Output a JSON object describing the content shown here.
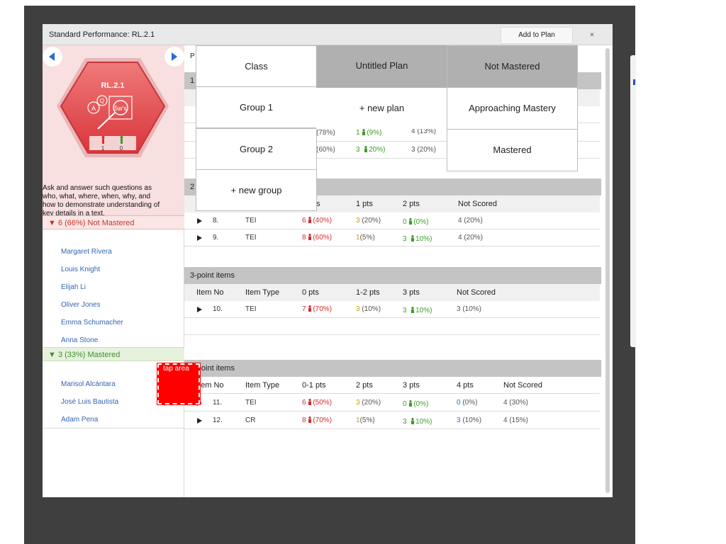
{
  "window": {
    "title": "Standard Performance: RL.2.1",
    "add_to_plan": "Add to Plan",
    "close": "×"
  },
  "standard": {
    "code": "RL.2.1",
    "icon_text": "5w's",
    "icon_letters": [
      "Q",
      "A"
    ],
    "not_mastered_count": "1",
    "mastered_count": "0",
    "description_lines": [
      "Ask and answer such questions as",
      "who, what, where, when, why, and",
      "how to demonstrate understanding of",
      "key details in a text."
    ]
  },
  "groups": {
    "not_mastered": {
      "header": "▼ 6 (66%) Not Mastered",
      "students": [
        "Margaret Rivera",
        "Louis Knight",
        "Elijah Li",
        "Oliver Jones",
        "Emma Schumacher",
        "Anna Stone"
      ]
    },
    "mastered": {
      "header": "▼ 3 (33%) Mastered",
      "students": [
        "Marisol Alcántara",
        "José Luis Bautista",
        "Adam Pena"
      ]
    }
  },
  "main": {
    "top_label": "P",
    "section1": {
      "marker": "1",
      "rows": [
        {
          "c1": "(78%)",
          "c2": "1",
          "c2b": "(9%)",
          "c3": "4 (13%)"
        },
        {
          "c1": "(60%)",
          "c2": "3",
          "c2b": "20%)",
          "c3": "3 (20%)"
        }
      ]
    },
    "section2": {
      "marker": "2",
      "headers": {
        "c0": "s",
        "c1": "1 pts",
        "c2": "2 pts",
        "c3": "Not Scored"
      },
      "rows": [
        {
          "no": "8.",
          "type": "TEI",
          "a": "6",
          "ap": "(40%)",
          "b": "3",
          "bp": "(20%)",
          "c": "0",
          "cp": "(0%)",
          "ns": "4 (20%)"
        },
        {
          "no": "9.",
          "type": "TEI",
          "a": "8",
          "ap": "(60%)",
          "b": "1",
          "bp": "(5%)",
          "c": "3",
          "cp": "10%)",
          "ns": "4 (20%)"
        }
      ]
    },
    "section3": {
      "title": "3-point items",
      "headers": {
        "no": "Item No",
        "type": "Item Type",
        "a": "0 pts",
        "b": "1-2 pts",
        "c": "3 pts",
        "ns": "Not Scored"
      },
      "rows": [
        {
          "no": "10.",
          "type": "TEI",
          "a": "7",
          "ap": "(70%)",
          "b": "3",
          "bp": "(10%)",
          "c": "3",
          "cp": "10%)",
          "ns": "3 (10%)"
        }
      ]
    },
    "section4": {
      "title": "4-point items",
      "headers": {
        "no": "Item No",
        "type": "Item Type",
        "a": "0-1 pts",
        "b": "2 pts",
        "c": "3 pts",
        "d": "4 pts",
        "ns": "Not Scored"
      },
      "rows": [
        {
          "no": "11.",
          "type": "TEI",
          "a": "6",
          "ap": "(50%)",
          "b": "3",
          "bp": "(20%)",
          "c": "0",
          "cp": "(0%)",
          "d": "0",
          "dp": "(0%)",
          "ns": "4 (30%)"
        },
        {
          "no": "12.",
          "type": "CR",
          "a": "8",
          "ap": "(70%)",
          "b": "1",
          "bp": "(5%)",
          "c": "3",
          "cp": "10%)",
          "d": "3",
          "dp": "(10%)",
          "ns": "4 (15%)"
        }
      ]
    }
  },
  "menu": {
    "col1": [
      "Class",
      "Group 1",
      "Group 2",
      "+ new group"
    ],
    "col2": [
      "Untitled Plan",
      "+ new plan"
    ],
    "col3": [
      "Not Mastered",
      "Approaching Mastery",
      "Mastered"
    ]
  },
  "tap_area": {
    "label": "tap area"
  },
  "colors": {
    "not_mastered": "#d62b2b",
    "approaching": "#c89a00",
    "mastered": "#3d9c28",
    "full_credit": "#2a6ad8",
    "tap_area": "#ff0000"
  }
}
